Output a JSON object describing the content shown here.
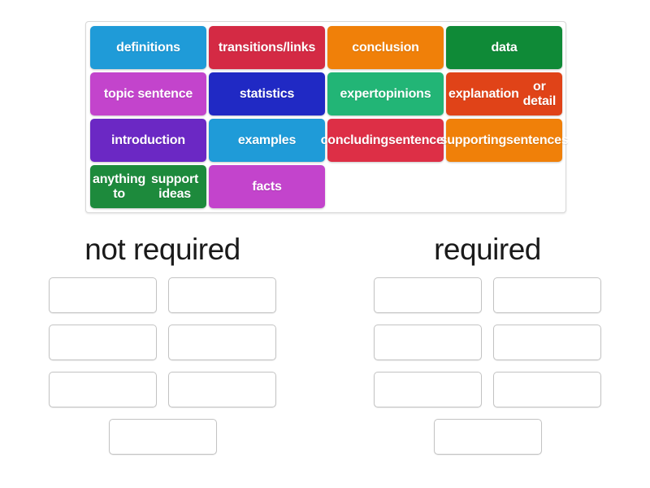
{
  "word_bank": {
    "name": "word-bank",
    "rows": [
      [
        {
          "label": "definitions",
          "color": "#1f9bd8"
        },
        {
          "label": "transitions/links",
          "color": "#d42a44"
        },
        {
          "label": "conclusion",
          "color": "#f08009"
        },
        {
          "label": "data",
          "color": "#0f8a37"
        }
      ],
      [
        {
          "label": "topic sentence",
          "color": "#c344cc"
        },
        {
          "label": "statistics",
          "color": "#2029c4"
        },
        {
          "label": "expert opinions",
          "color": "#22b576",
          "lines": [
            "expert",
            "opinions"
          ]
        },
        {
          "label": "explanation or detail",
          "color": "#e04318",
          "lines": [
            "explanation",
            "or detail"
          ]
        }
      ],
      [
        {
          "label": "introduction",
          "color": "#6b28c4"
        },
        {
          "label": "examples",
          "color": "#1f9bd8"
        },
        {
          "label": "concluding sentences",
          "color": "#dd2f46",
          "lines": [
            "concluding",
            "sentences"
          ]
        },
        {
          "label": "supporting sentences",
          "color": "#f08009",
          "lines": [
            "supporting",
            "sentences"
          ]
        }
      ],
      [
        {
          "label": "anything to support ideas",
          "color": "#1d8a3c",
          "lines": [
            "anything to",
            "support ideas"
          ]
        },
        {
          "label": "facts",
          "color": "#c344cc"
        }
      ]
    ]
  },
  "drop_zones": {
    "columns": [
      {
        "title": "not required",
        "rows": [
          {
            "slots": 2
          },
          {
            "slots": 2
          },
          {
            "slots": 2
          },
          {
            "slots": 1
          }
        ]
      },
      {
        "title": "required",
        "rows": [
          {
            "slots": 2
          },
          {
            "slots": 2
          },
          {
            "slots": 2
          },
          {
            "slots": 1
          }
        ]
      }
    ]
  }
}
